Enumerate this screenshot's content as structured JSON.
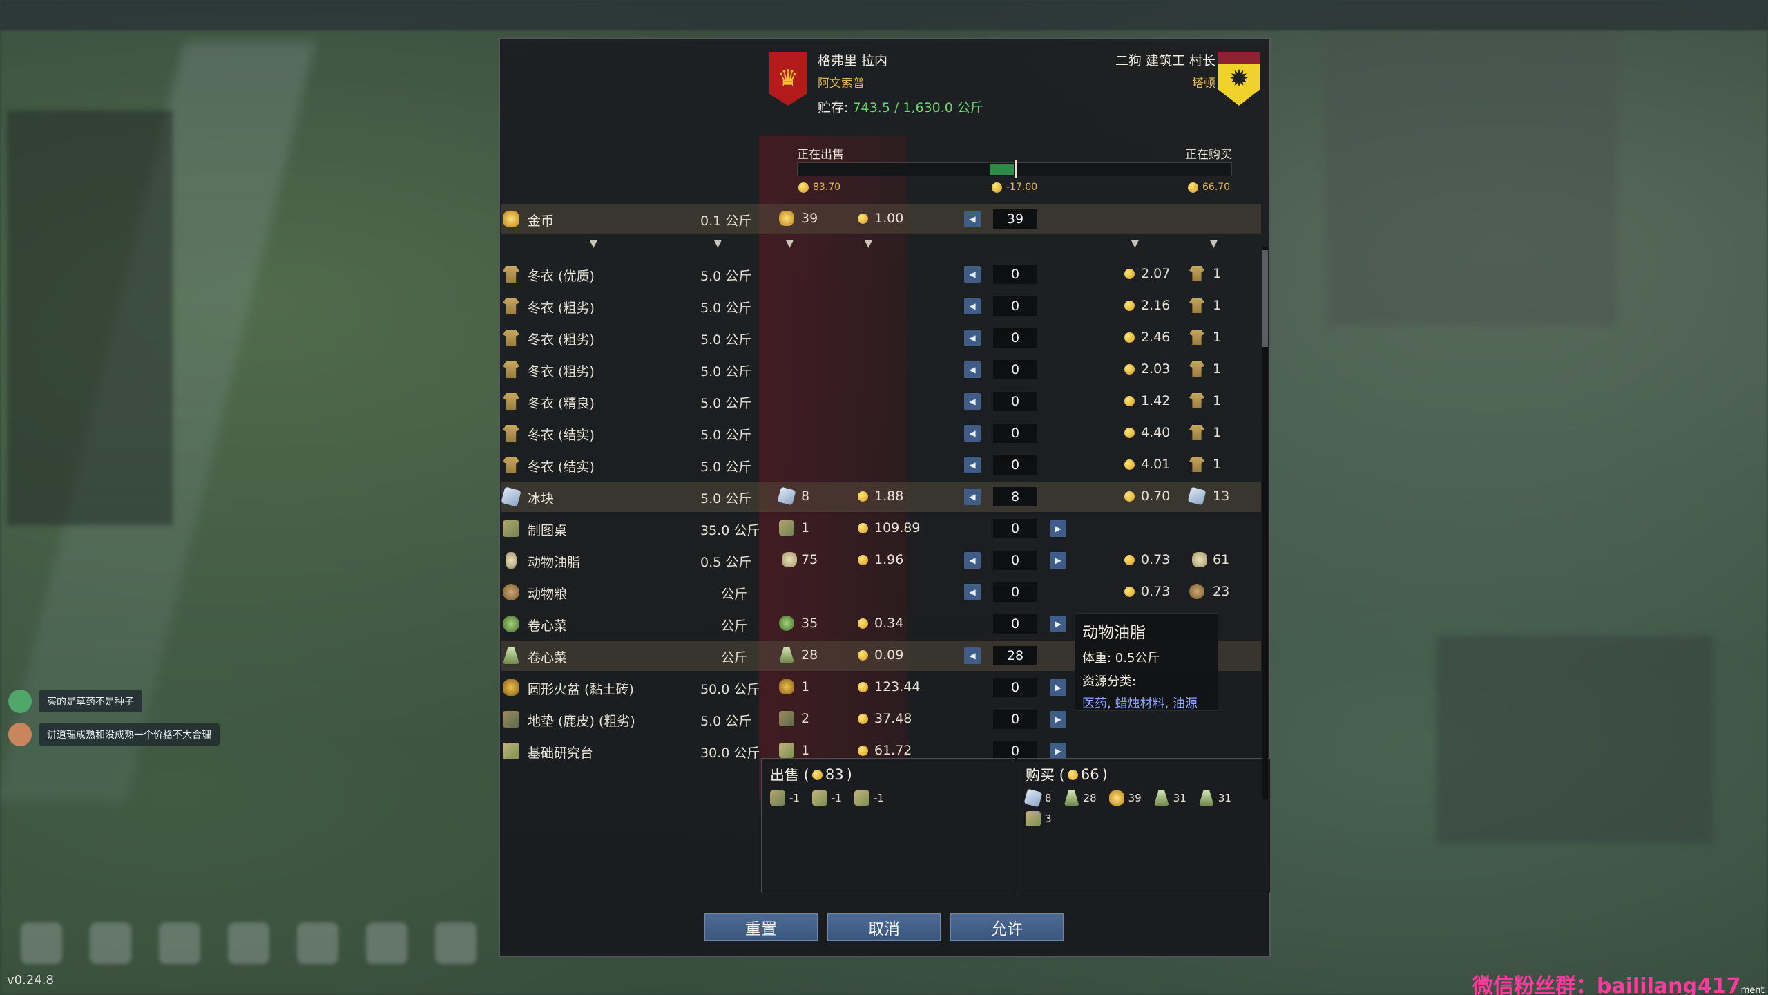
{
  "left_faction": {
    "name": "格弗里 拉内",
    "sub": "阿文索普",
    "storage_label": "贮存:",
    "storage_value": "743.5 / 1,630.0 公斤"
  },
  "right_faction": {
    "name": "二狗  建筑工 村长",
    "sub": "塔顿"
  },
  "balance": {
    "selling_label": "正在出售",
    "buying_label": "正在购买",
    "left_value": "83.70",
    "mid_value": "-17.00",
    "right_value": "66.70"
  },
  "currency_row": {
    "name": "金币",
    "weight": "0.1 公斤",
    "stock": "39",
    "price": "1.00",
    "qty": "39"
  },
  "items": [
    {
      "icon": "cloth",
      "name": "冬衣 (优质)",
      "weight": "5.0 公斤",
      "stock": "",
      "price": "",
      "qty": "0",
      "left": true,
      "right": false,
      "their_price": "2.07",
      "their_stock": "1",
      "hl": false
    },
    {
      "icon": "cloth",
      "name": "冬衣 (粗劣)",
      "weight": "5.0 公斤",
      "stock": "",
      "price": "",
      "qty": "0",
      "left": true,
      "right": false,
      "their_price": "2.16",
      "their_stock": "1",
      "hl": false
    },
    {
      "icon": "cloth",
      "name": "冬衣 (粗劣)",
      "weight": "5.0 公斤",
      "stock": "",
      "price": "",
      "qty": "0",
      "left": true,
      "right": false,
      "their_price": "2.46",
      "their_stock": "1",
      "hl": false
    },
    {
      "icon": "cloth",
      "name": "冬衣 (粗劣)",
      "weight": "5.0 公斤",
      "stock": "",
      "price": "",
      "qty": "0",
      "left": true,
      "right": false,
      "their_price": "2.03",
      "their_stock": "1",
      "hl": false
    },
    {
      "icon": "cloth",
      "name": "冬衣 (精良)",
      "weight": "5.0 公斤",
      "stock": "",
      "price": "",
      "qty": "0",
      "left": true,
      "right": false,
      "their_price": "1.42",
      "their_stock": "1",
      "hl": false
    },
    {
      "icon": "cloth",
      "name": "冬衣 (结实)",
      "weight": "5.0 公斤",
      "stock": "",
      "price": "",
      "qty": "0",
      "left": true,
      "right": false,
      "their_price": "4.40",
      "their_stock": "1",
      "hl": false
    },
    {
      "icon": "cloth",
      "name": "冬衣 (结实)",
      "weight": "5.0 公斤",
      "stock": "",
      "price": "",
      "qty": "0",
      "left": true,
      "right": false,
      "their_price": "4.01",
      "their_stock": "1",
      "hl": false
    },
    {
      "icon": "ice",
      "name": "冰块",
      "weight": "5.0 公斤",
      "stock": "8",
      "price": "1.88",
      "qty": "8",
      "left": true,
      "right": false,
      "their_price": "0.70",
      "their_stock": "13",
      "hl": true
    },
    {
      "icon": "table",
      "name": "制图桌",
      "weight": "35.0 公斤",
      "stock": "1",
      "price": "109.89",
      "qty": "0",
      "left": false,
      "right": true,
      "their_price": "",
      "their_stock": "",
      "hl": false
    },
    {
      "icon": "fat",
      "name": "动物油脂",
      "weight": "0.5 公斤",
      "stock": "75",
      "price": "1.96",
      "qty": "0",
      "left": true,
      "right": true,
      "their_price": "0.73",
      "their_stock": "61",
      "hl": false
    },
    {
      "icon": "grain",
      "name": "动物粮",
      "weight": "公斤",
      "stock": "",
      "price": "",
      "qty": "0",
      "left": true,
      "right": false,
      "their_price": "0.73",
      "their_stock": "23",
      "hl": false
    },
    {
      "icon": "cabbage",
      "name": "卷心菜",
      "weight": "公斤",
      "stock": "35",
      "price": "0.34",
      "qty": "0",
      "left": false,
      "right": true,
      "their_price": "",
      "their_stock": "",
      "hl": false
    },
    {
      "icon": "seed",
      "name": "卷心菜",
      "weight": "公斤",
      "stock": "28",
      "price": "0.09",
      "qty": "28",
      "left": true,
      "right": false,
      "their_price": "",
      "their_stock": "",
      "hl": true
    },
    {
      "icon": "brazier",
      "name": "圆形火盆 (黏土砖)",
      "weight": "50.0 公斤",
      "stock": "1",
      "price": "123.44",
      "qty": "0",
      "left": false,
      "right": true,
      "their_price": "",
      "their_stock": "",
      "hl": false
    },
    {
      "icon": "mat",
      "name": "地垫 (鹿皮) (粗劣)",
      "weight": "5.0 公斤",
      "stock": "2",
      "price": "37.48",
      "qty": "0",
      "left": false,
      "right": true,
      "their_price": "",
      "their_stock": "",
      "hl": false
    },
    {
      "icon": "research",
      "name": "基础研究台",
      "weight": "30.0 公斤",
      "stock": "1",
      "price": "61.72",
      "qty": "0",
      "left": false,
      "right": true,
      "their_price": "",
      "their_stock": "",
      "hl": false
    }
  ],
  "tooltip": {
    "title": "动物油脂",
    "weight": "体重: 0.5公斤",
    "category_label": "资源分类:",
    "categories": "医药, 蜡烛材料, 油源"
  },
  "sell_summary": {
    "label": "出售 (",
    "amount": "83",
    "close": ")",
    "items": [
      {
        "icon": "table",
        "count": "-1"
      },
      {
        "icon": "research",
        "count": "-1"
      },
      {
        "icon": "research",
        "count": "-1"
      }
    ]
  },
  "buy_summary": {
    "label": "购买 (",
    "amount": "66",
    "close": ")",
    "items": [
      {
        "icon": "ice",
        "count": "8"
      },
      {
        "icon": "seed",
        "count": "28"
      },
      {
        "icon": "gold",
        "count": "39"
      },
      {
        "icon": "seed",
        "count": "31"
      },
      {
        "icon": "seed",
        "count": "31"
      },
      {
        "icon": "tool",
        "count": "3"
      }
    ]
  },
  "buttons": {
    "reset": "重置",
    "cancel": "取消",
    "accept": "允许"
  },
  "chat": [
    {
      "text": "买的是草药不是种子",
      "color": "#4fa86a"
    },
    {
      "text": "讲道理成熟和没成熟一个价格不大合理",
      "color": "#c9855c"
    }
  ],
  "version": "v0.24.8",
  "watermark": "微信粉丝群：baililang417",
  "watermark_suffix": "ment Build"
}
